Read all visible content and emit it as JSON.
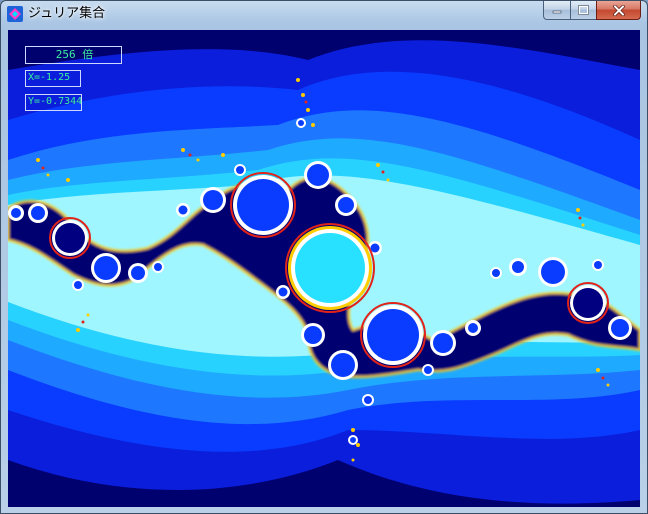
{
  "window": {
    "title": "ジュリア集合",
    "app_icon": "app-diamond-icon"
  },
  "caption_buttons": {
    "minimize": "minimize-icon",
    "maximize": "maximize-icon",
    "close": "close-icon"
  },
  "hud": {
    "zoom": "256 倍",
    "x": "X=-1.25",
    "y": "Y=-0.7344"
  },
  "colors": {
    "background_deep": "#00006e",
    "band_blue": "#0a3cff",
    "band_mid": "#1e90ff",
    "band_cyan": "#28d2ff",
    "band_light": "#9ff6ff",
    "fractal_core": "#000070",
    "rim_yellow": "#ffcc00",
    "rim_red": "#e2231a",
    "text_green": "#3cf0a0"
  }
}
